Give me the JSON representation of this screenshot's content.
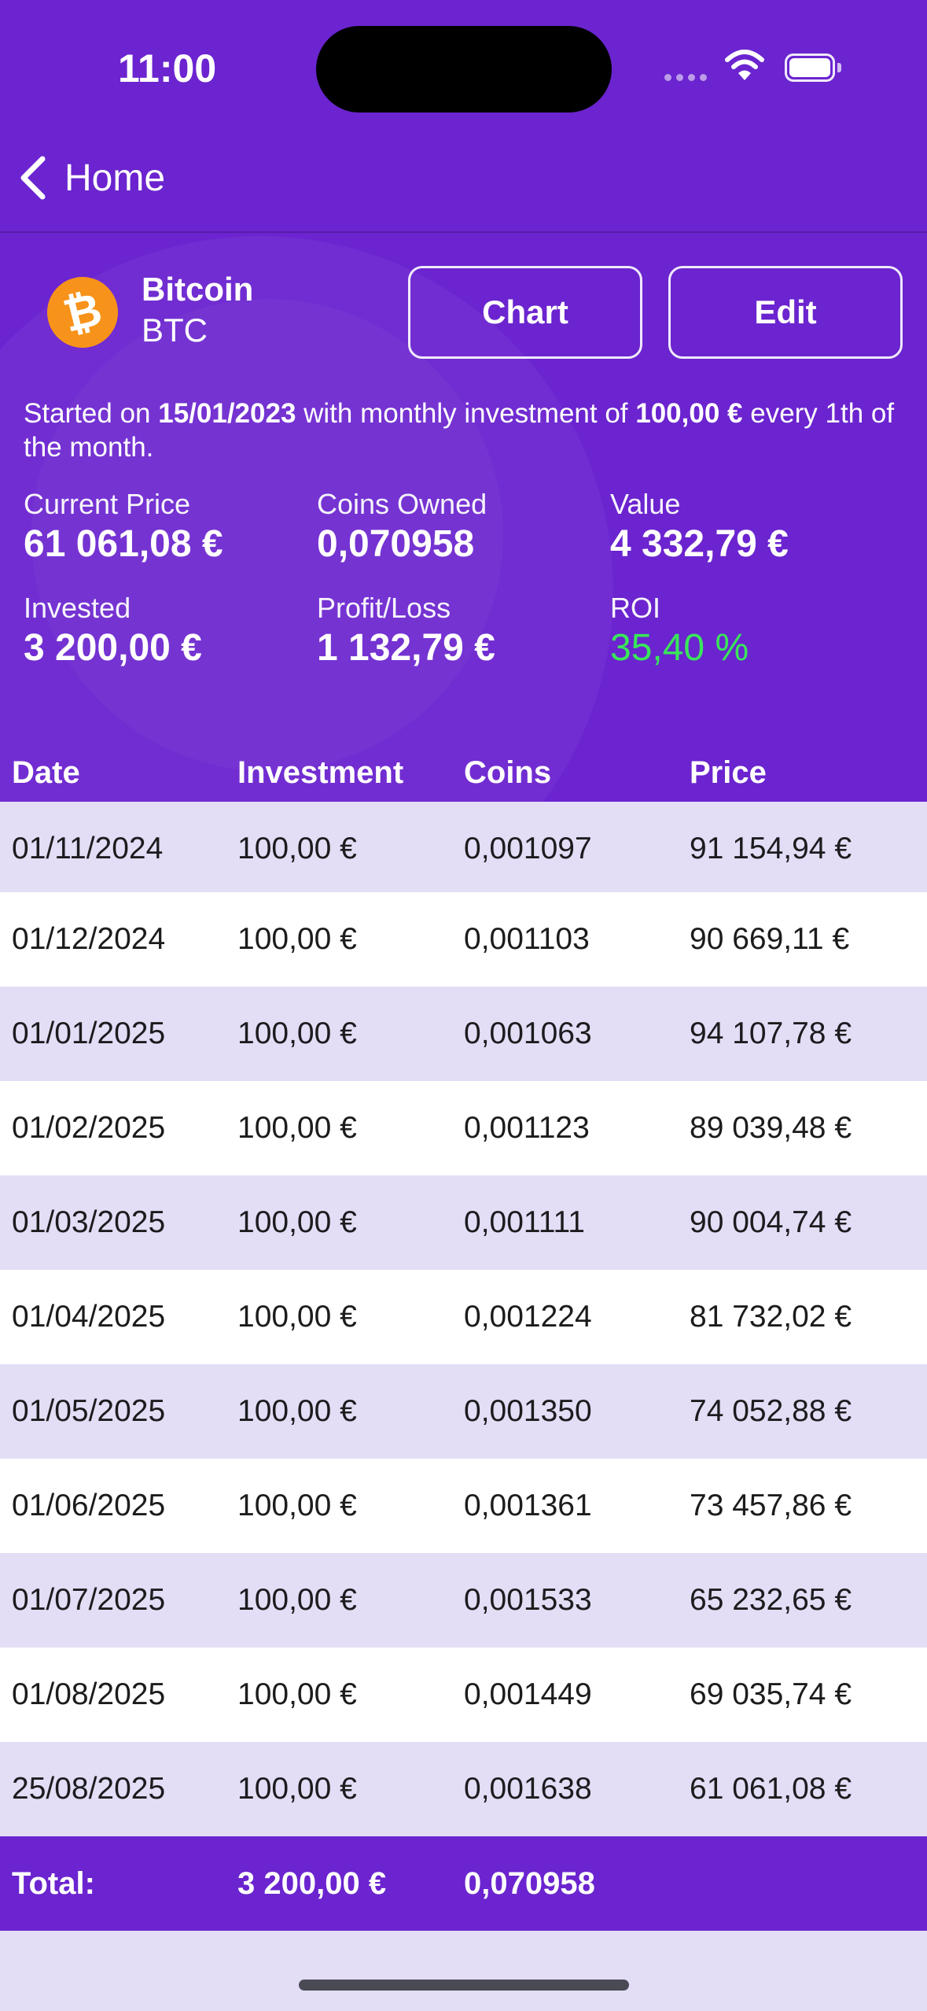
{
  "status_bar": {
    "time": "11:00"
  },
  "nav": {
    "back_label": "Home"
  },
  "coin": {
    "name": "Bitcoin",
    "symbol": "BTC",
    "logo_char": "₿",
    "logo_color": "#F7931A"
  },
  "actions": {
    "chart_label": "Chart",
    "edit_label": "Edit"
  },
  "summary": {
    "prefix": "Started on ",
    "start_date": "15/01/2023",
    "middle": " with monthly investment of ",
    "amount": "100,00 €",
    "suffix": " every 1th of the month."
  },
  "stats": {
    "current_price": {
      "label": "Current Price",
      "value": "61 061,08 €"
    },
    "coins_owned": {
      "label": "Coins Owned",
      "value": "0,070958"
    },
    "value": {
      "label": "Value",
      "value": "4 332,79 €"
    },
    "invested": {
      "label": "Invested",
      "value": "3 200,00 €"
    },
    "profit_loss": {
      "label": "Profit/Loss",
      "value": "1 132,79 €"
    },
    "roi": {
      "label": "ROI",
      "value": "35,40 %"
    }
  },
  "table": {
    "headers": [
      "Date",
      "Investment",
      "Coins",
      "Price"
    ],
    "rows": [
      [
        "01/11/2024",
        "100,00 €",
        "0,001097",
        "91 154,94 €"
      ],
      [
        "01/12/2024",
        "100,00 €",
        "0,001103",
        "90 669,11 €"
      ],
      [
        "01/01/2025",
        "100,00 €",
        "0,001063",
        "94 107,78 €"
      ],
      [
        "01/02/2025",
        "100,00 €",
        "0,001123",
        "89 039,48 €"
      ],
      [
        "01/03/2025",
        "100,00 €",
        "0,001111",
        "90 004,74 €"
      ],
      [
        "01/04/2025",
        "100,00 €",
        "0,001224",
        "81 732,02 €"
      ],
      [
        "01/05/2025",
        "100,00 €",
        "0,001350",
        "74 052,88 €"
      ],
      [
        "01/06/2025",
        "100,00 €",
        "0,001361",
        "73 457,86 €"
      ],
      [
        "01/07/2025",
        "100,00 €",
        "0,001533",
        "65 232,65 €"
      ],
      [
        "01/08/2025",
        "100,00 €",
        "0,001449",
        "69 035,74 €"
      ],
      [
        "25/08/2025",
        "100,00 €",
        "0,001638",
        "61 061,08 €"
      ]
    ],
    "total": {
      "label": "Total:",
      "investment": "3 200,00 €",
      "coins": "0,070958"
    }
  },
  "colors": {
    "brand": "#6B24CF",
    "row_alt": "#E3DDF6",
    "roi_positive": "#39E65A"
  }
}
